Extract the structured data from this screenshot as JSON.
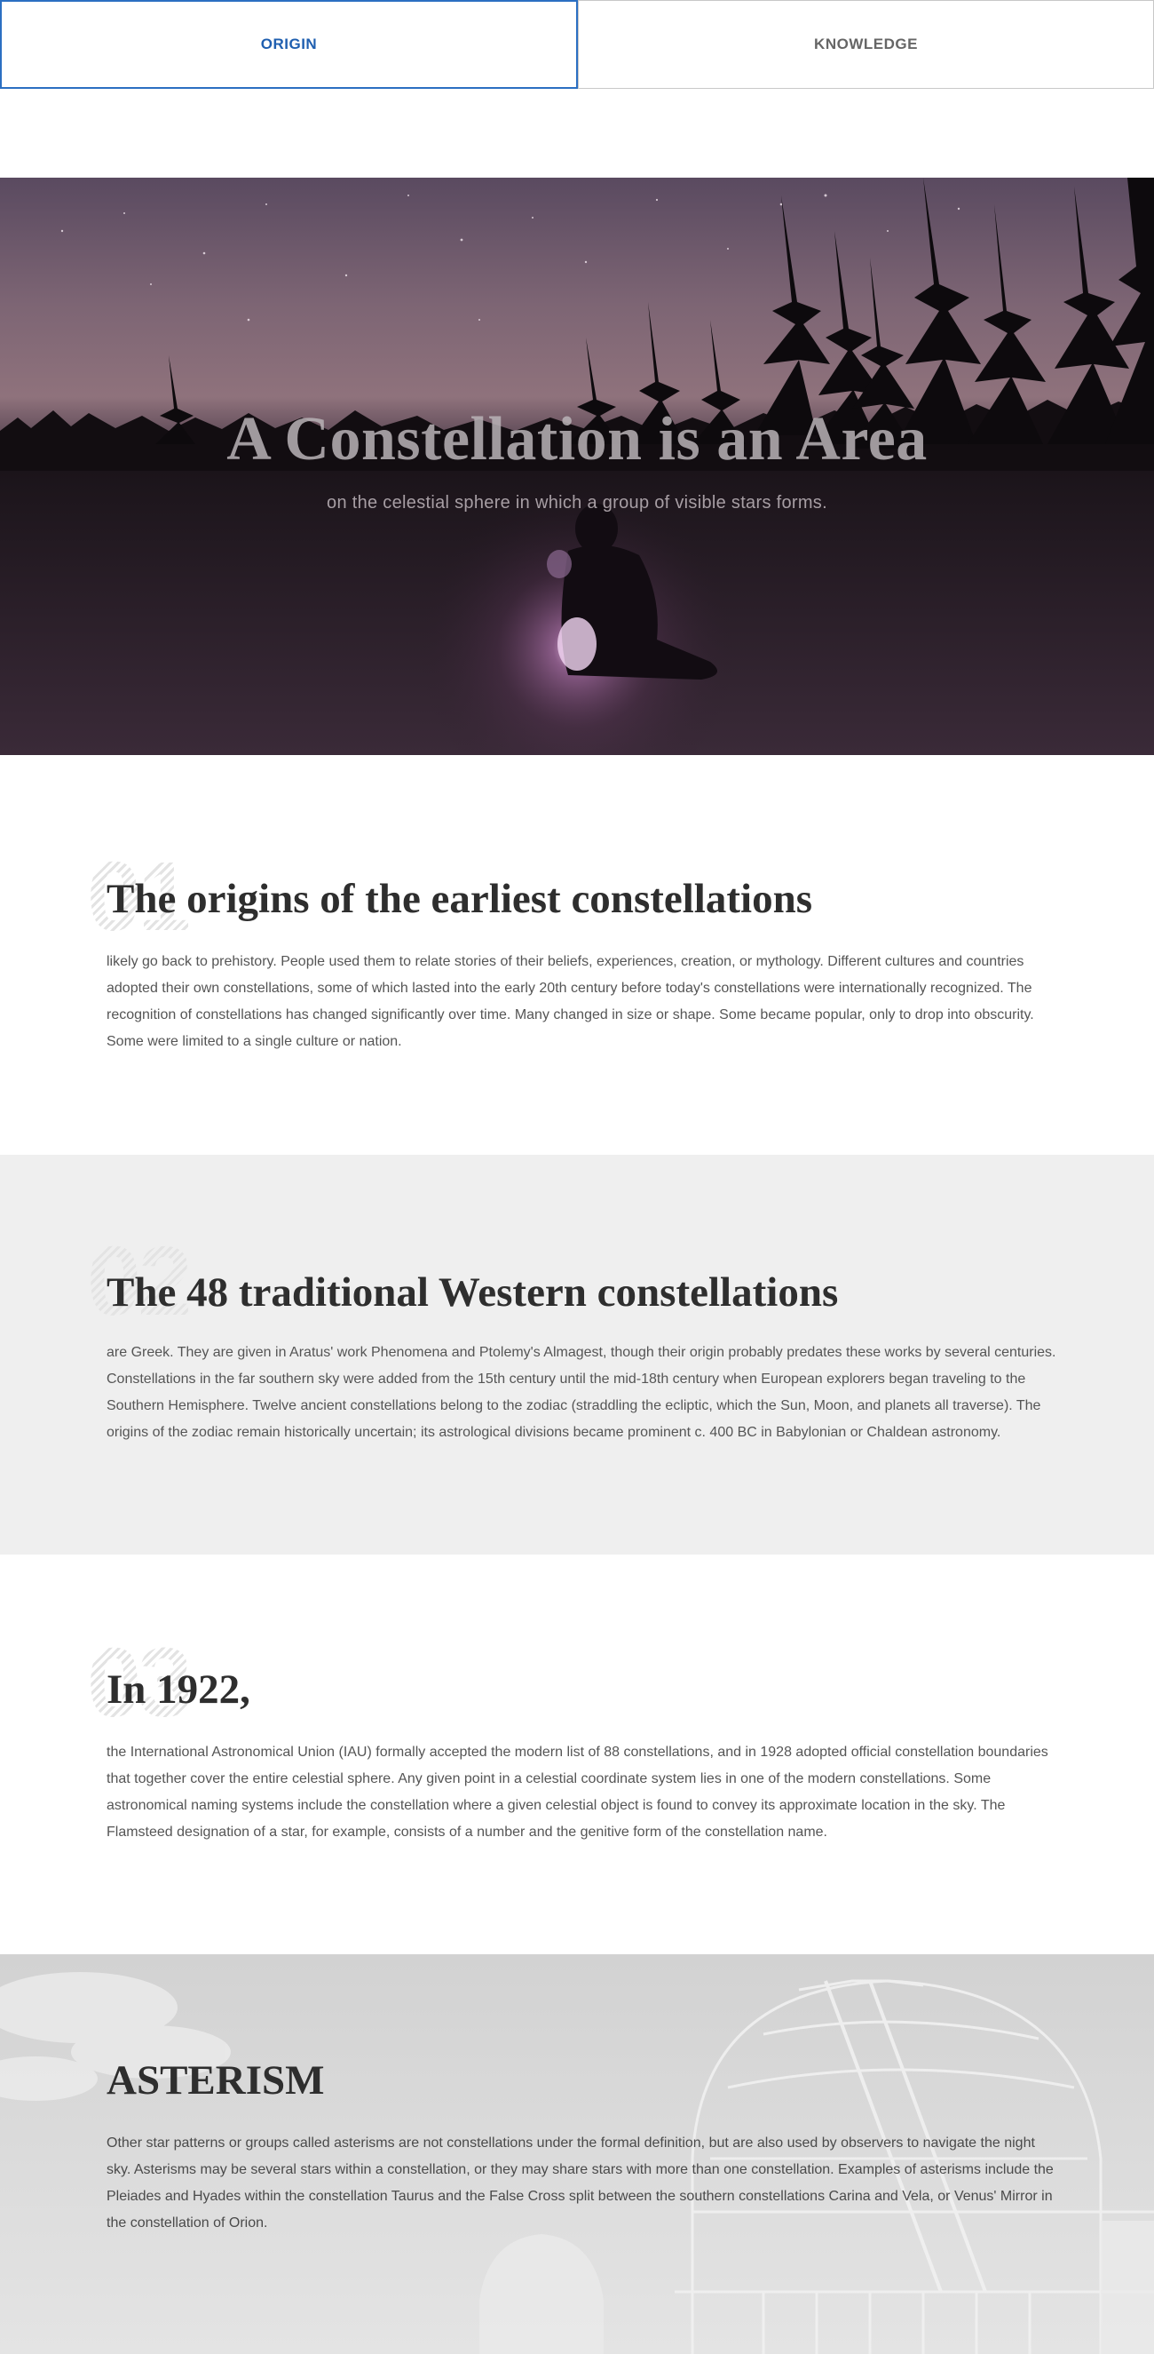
{
  "tabs": [
    {
      "label": "ORIGIN",
      "active": true
    },
    {
      "label": "KNOWLEDGE",
      "active": false
    }
  ],
  "hero": {
    "title": "A Constellation is an Area",
    "subtitle": "on the celestial sphere in which a group of visible stars forms."
  },
  "sections": [
    {
      "number": "01",
      "title": "The origins of the earliest constellations",
      "text": "likely go back to prehistory. People used them to relate stories of their beliefs, experiences, creation, or mythology. Different cultures and countries adopted their own constellations, some of which lasted into the early 20th century before today's constellations were internationally recognized. The recognition of constellations has changed significantly over time. Many changed in size or shape. Some became popular, only to drop into obscurity. Some were limited to a single culture or nation."
    },
    {
      "number": "02",
      "title": "The 48 traditional Western constellations",
      "text": "are Greek. They are given in Aratus' work Phenomena and Ptolemy's Almagest, though their origin probably predates these works by several centuries. Constellations in the far southern sky were added from the 15th century until the mid-18th century when European explorers began traveling to the Southern Hemisphere. Twelve ancient constellations belong to the zodiac (straddling the ecliptic, which the Sun, Moon, and planets all traverse). The origins of the zodiac remain historically uncertain; its astrological divisions became prominent c. 400 BC in Babylonian or Chaldean astronomy."
    },
    {
      "number": "03",
      "title": "In 1922,",
      "text": "the International Astronomical Union (IAU) formally accepted the modern list of 88 constellations, and in 1928 adopted official constellation boundaries that together cover the entire celestial sphere. Any given point in a celestial coordinate system lies in one of the modern constellations. Some astronomical naming systems include the constellation where a given celestial object is found to convey its approximate location in the sky. The Flamsteed designation of a star, for example, consists of a number and the genitive form of the constellation name."
    }
  ],
  "asterism": {
    "title": "ASTERISM",
    "text": "Other star patterns or groups called asterisms are not constellations under the formal definition, but are also used by observers to navigate the night sky. Asterisms may be several stars within a constellation, or they may share stars with more than one constellation. Examples of asterisms include the Pleiades and Hyades within the constellation Taurus and the False Cross split between the southern constellations Carina and Vela, or Venus' Mirror in the constellation of Orion."
  },
  "colors": {
    "accent": "#2b6fc2",
    "section_alt_bg": "#efefef"
  }
}
